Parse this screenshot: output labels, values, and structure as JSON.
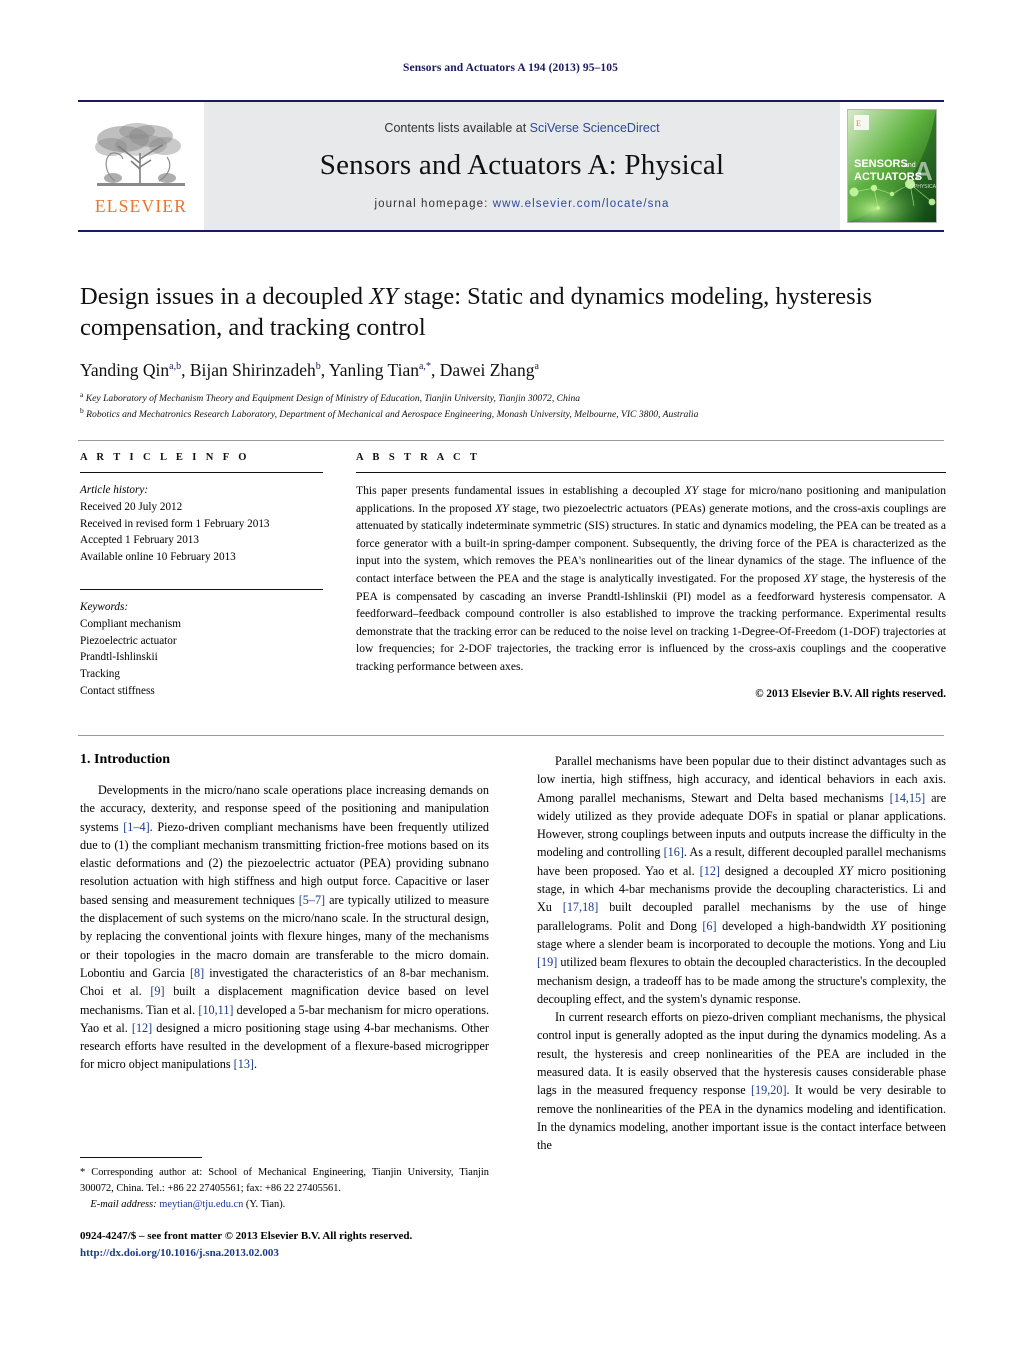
{
  "running_head": "Sensors and Actuators A 194 (2013) 95–105",
  "masthead": {
    "contents_prefix": "Contents lists available at ",
    "sciencedirect": "SciVerse ScienceDirect",
    "journal_title": "Sensors and Actuators A: Physical",
    "homepage_label": "journal homepage:",
    "homepage_url": "www.elsevier.com/locate/sna",
    "publisher_name": "ELSEVIER",
    "cover_title_line1": "SENSORS",
    "cover_title_and": "and",
    "cover_title_line2": "ACTUATORS",
    "cover_letter": "A",
    "cover_sub": "PHYSICAL",
    "accent_orange": "#E8762C",
    "accent_navy": "#1a1a5e",
    "band_gray": "#e8e9eb",
    "cover_green": "#3faa35"
  },
  "title": "Design issues in a decoupled XY stage: Static and dynamics modeling, hysteresis compensation, and tracking control",
  "authors_html": "Yanding Qin<sup>a,b</sup>, Bijan Shirinzadeh<sup>b</sup>, Yanling Tian<sup>a,</sup><sup>*</sup>, Dawei Zhang<sup>a</sup>",
  "affiliations": [
    "Key Laboratory of Mechanism Theory and Equipment Design of Ministry of Education, Tianjin University, Tianjin 30072, China",
    "Robotics and Mechatronics Research Laboratory, Department of Mechanical and Aerospace Engineering, Monash University, Melbourne, VIC 3800, Australia"
  ],
  "affiliation_marks": [
    "a",
    "b"
  ],
  "article_info": {
    "heading": "A R T I C L E    I N F O",
    "history_label": "Article history:",
    "history": [
      "Received 20 July 2012",
      "Received in revised form 1 February 2013",
      "Accepted 1 February 2013",
      "Available online 10 February 2013"
    ],
    "keywords_label": "Keywords:",
    "keywords": [
      "Compliant mechanism",
      "Piezoelectric actuator",
      "Prandtl-Ishlinskii",
      "Tracking",
      "Contact stiffness"
    ]
  },
  "abstract": {
    "heading": "A B S T R A C T",
    "text_html": "This paper presents fundamental issues in establishing a decoupled <em>XY</em> stage for micro/nano positioning and manipulation applications. In the proposed <em>XY</em> stage, two piezoelectric actuators (PEAs) generate motions, and the cross-axis couplings are attenuated by statically indeterminate symmetric (SIS) structures. In static and dynamics modeling, the PEA can be treated as a force generator with a built-in spring-damper component. Subsequently, the driving force of the PEA is characterized as the input into the system, which removes the PEA's nonlinearities out of the linear dynamics of the stage. The influence of the contact interface between the PEA and the stage is analytically investigated. For the proposed <em>XY</em> stage, the hysteresis of the PEA is compensated by cascading an inverse Prandtl-Ishlinskii (PI) model as a feedforward hysteresis compensator. A feedforward–feedback compound controller is also established to improve the tracking performance. Experimental results demonstrate that the tracking error can be reduced to the noise level on tracking 1-Degree-Of-Freedom (1-DOF) trajectories at low frequencies; for 2-DOF trajectories, the tracking error is influenced by the cross-axis couplings and the cooperative tracking performance between axes.",
    "copyright": "© 2013 Elsevier B.V. All rights reserved."
  },
  "body": {
    "section_heading": "1.  Introduction",
    "left_paragraphs_html": [
      "Developments in the micro/nano scale operations place increasing demands on the accuracy, dexterity, and response speed of the positioning and manipulation systems <span class=\"ref\">[1–4]</span>. Piezo-driven compliant mechanisms have been frequently utilized due to (1) the compliant mechanism transmitting friction-free motions based on its elastic deformations and (2) the piezoelectric actuator (PEA) providing subnano resolution actuation with high stiffness and high output force. Capacitive or laser based sensing and measurement techniques <span class=\"ref\">[5–7]</span> are typically utilized to measure the displacement of such systems on the micro/nano scale. In the structural design, by replacing the conventional joints with flexure hinges, many of the mechanisms or their topologies in the macro domain are transferable to the micro domain. Lobontiu and Garcia <span class=\"ref\">[8]</span> investigated the characteristics of an 8-bar mechanism. Choi et al. <span class=\"ref\">[9]</span> built a displacement magnification device based on level mechanisms. Tian et al. <span class=\"ref\">[10,11]</span> developed a 5-bar mechanism for micro operations. Yao et al. <span class=\"ref\">[12]</span> designed a micro positioning stage using 4-bar mechanisms. Other research efforts have resulted in the development of a flexure-based microgripper for micro object manipulations <span class=\"ref\">[13]</span>."
    ],
    "right_paragraphs_html": [
      "Parallel mechanisms have been popular due to their distinct advantages such as low inertia, high stiffness, high accuracy, and identical behaviors in each axis. Among parallel mechanisms, Stewart and Delta based mechanisms <span class=\"ref\">[14,15]</span> are widely utilized as they provide adequate DOFs in spatial or planar applications. However, strong couplings between inputs and outputs increase the difficulty in the modeling and controlling <span class=\"ref\">[16]</span>. As a result, different decoupled parallel mechanisms have been proposed. Yao et al. <span class=\"ref\">[12]</span> designed a decoupled <em>XY</em> micro positioning stage, in which 4-bar mechanisms provide the decoupling characteristics. Li and Xu <span class=\"ref\">[17,18]</span> built decoupled parallel mechanisms by the use of hinge parallelograms. Polit and Dong <span class=\"ref\">[6]</span> developed a high-bandwidth <em>XY</em> positioning stage where a slender beam is incorporated to decouple the motions. Yong and Liu <span class=\"ref\">[19]</span> utilized beam flexures to obtain the decoupled characteristics. In the decoupled mechanism design, a tradeoff has to be made among the structure's complexity, the decoupling effect, and the system's dynamic response.",
      "In current research efforts on piezo-driven compliant mechanisms, the physical control input is generally adopted as the input during the dynamics modeling. As a result, the hysteresis and creep nonlinearities of the PEA are included in the measured data. It is easily observed that the hysteresis causes considerable phase lags in the measured frequency response <span class=\"ref\">[19,20]</span>. It would be very desirable to remove the nonlinearities of the PEA in the dynamics modeling and identification. In the dynamics modeling, another important issue is the contact interface between the"
    ]
  },
  "footnote": {
    "text_html": "<span class=\"star\">*</span> Corresponding author at: School of Mechanical Engineering, Tianjin University, Tianjin 300072, China. Tel.: +86 22 27405561; fax: +86 22 27405561.",
    "email_label": "E-mail address:",
    "email": "meytian@tju.edu.cn",
    "email_owner": "(Y. Tian)."
  },
  "bottom": {
    "issn_line": "0924-4247/$ – see front matter © 2013 Elsevier B.V. All rights reserved.",
    "doi_line": "http://dx.doi.org/10.1016/j.sna.2013.02.003"
  }
}
